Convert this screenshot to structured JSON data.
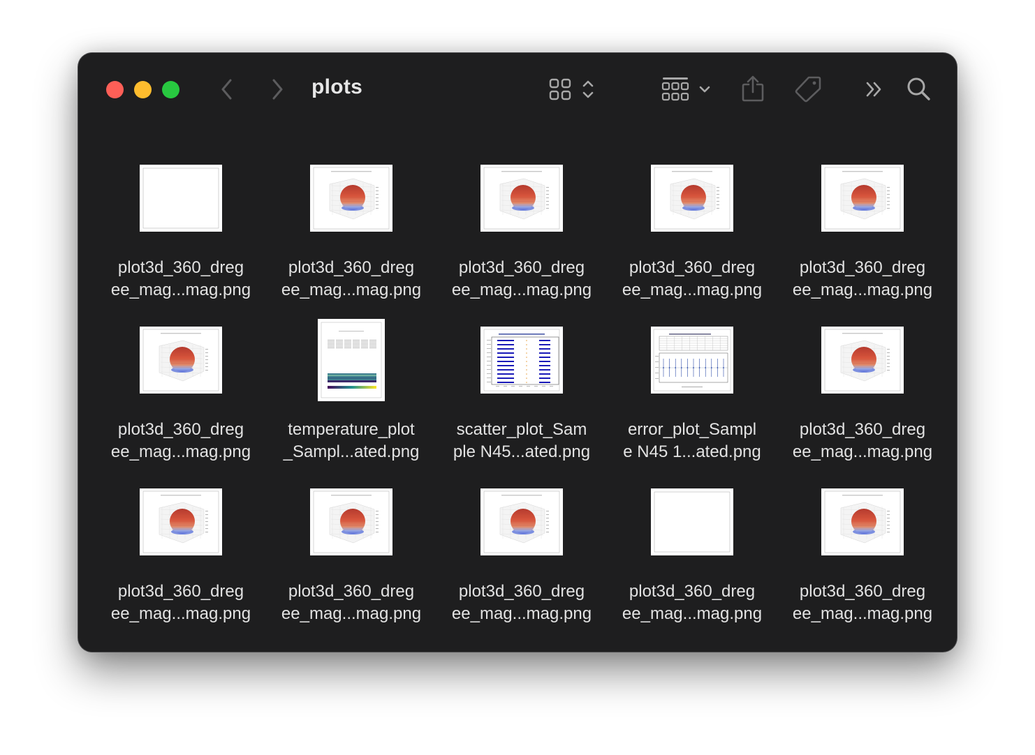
{
  "window": {
    "title": "plots"
  },
  "toolbar": {
    "back_icon": "chevron-left-icon",
    "forward_icon": "chevron-right-icon",
    "view_mode_icon": "grid-view-icon",
    "group_icon": "group-by-icon",
    "share_icon": "share-icon",
    "tag_icon": "tag-icon",
    "more_icon": "double-chevron-right-icon",
    "search_icon": "search-icon"
  },
  "colors": {
    "window_bg": "#1e1e1f",
    "close": "#fe5f57",
    "minimize": "#febc2e",
    "zoom": "#28c840",
    "text": "#e2e2e2"
  },
  "files": [
    {
      "line1": "plot3d_360_dreg",
      "line2": "ee_mag...mag.png",
      "thumb": "blank"
    },
    {
      "line1": "plot3d_360_dreg",
      "line2": "ee_mag...mag.png",
      "thumb": "sphere"
    },
    {
      "line1": "plot3d_360_dreg",
      "line2": "ee_mag...mag.png",
      "thumb": "sphere"
    },
    {
      "line1": "plot3d_360_dreg",
      "line2": "ee_mag...mag.png",
      "thumb": "sphere"
    },
    {
      "line1": "plot3d_360_dreg",
      "line2": "ee_mag...mag.png",
      "thumb": "sphere"
    },
    {
      "line1": "plot3d_360_dreg",
      "line2": "ee_mag...mag.png",
      "thumb": "sphere"
    },
    {
      "line1": "temperature_plot",
      "line2": "_Sampl...ated.png",
      "thumb": "temperature"
    },
    {
      "line1": "scatter_plot_Sam",
      "line2": "ple N45...ated.png",
      "thumb": "scatter"
    },
    {
      "line1": "error_plot_Sampl",
      "line2": "e N45 1...ated.png",
      "thumb": "error"
    },
    {
      "line1": "plot3d_360_dreg",
      "line2": "ee_mag...mag.png",
      "thumb": "sphere"
    },
    {
      "line1": "plot3d_360_dreg",
      "line2": "ee_mag...mag.png",
      "thumb": "sphere"
    },
    {
      "line1": "plot3d_360_dreg",
      "line2": "ee_mag...mag.png",
      "thumb": "sphere"
    },
    {
      "line1": "plot3d_360_dreg",
      "line2": "ee_mag...mag.png",
      "thumb": "sphere"
    },
    {
      "line1": "plot3d_360_dreg",
      "line2": "ee_mag...mag.png",
      "thumb": "blank"
    },
    {
      "line1": "plot3d_360_dreg",
      "line2": "ee_mag...mag.png",
      "thumb": "sphere"
    }
  ]
}
